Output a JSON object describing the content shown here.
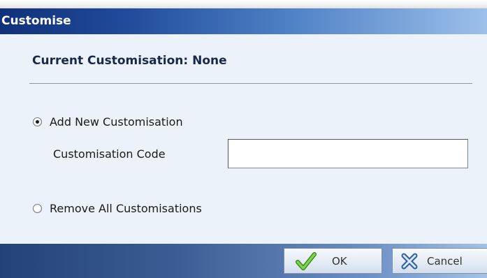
{
  "dialog": {
    "title": "Customise",
    "heading": "Current Customisation: None",
    "options": [
      {
        "label": "Add New Customisation",
        "checked": true
      },
      {
        "label": "Remove All Customisations",
        "checked": false
      }
    ],
    "code_field": {
      "label": "Customisation Code",
      "value": ""
    },
    "buttons": {
      "ok": {
        "label": "OK",
        "icon": "checkmark-icon"
      },
      "cancel": {
        "label": "Cancel",
        "icon": "cancel-x-icon"
      }
    }
  },
  "colors": {
    "title_bar_start": "#12307a",
    "title_bar_end": "#9cc0ea",
    "dialog_background": "#ebf2fa",
    "ok_check": "#5cb82e",
    "cancel_x": "#3f74b8"
  }
}
